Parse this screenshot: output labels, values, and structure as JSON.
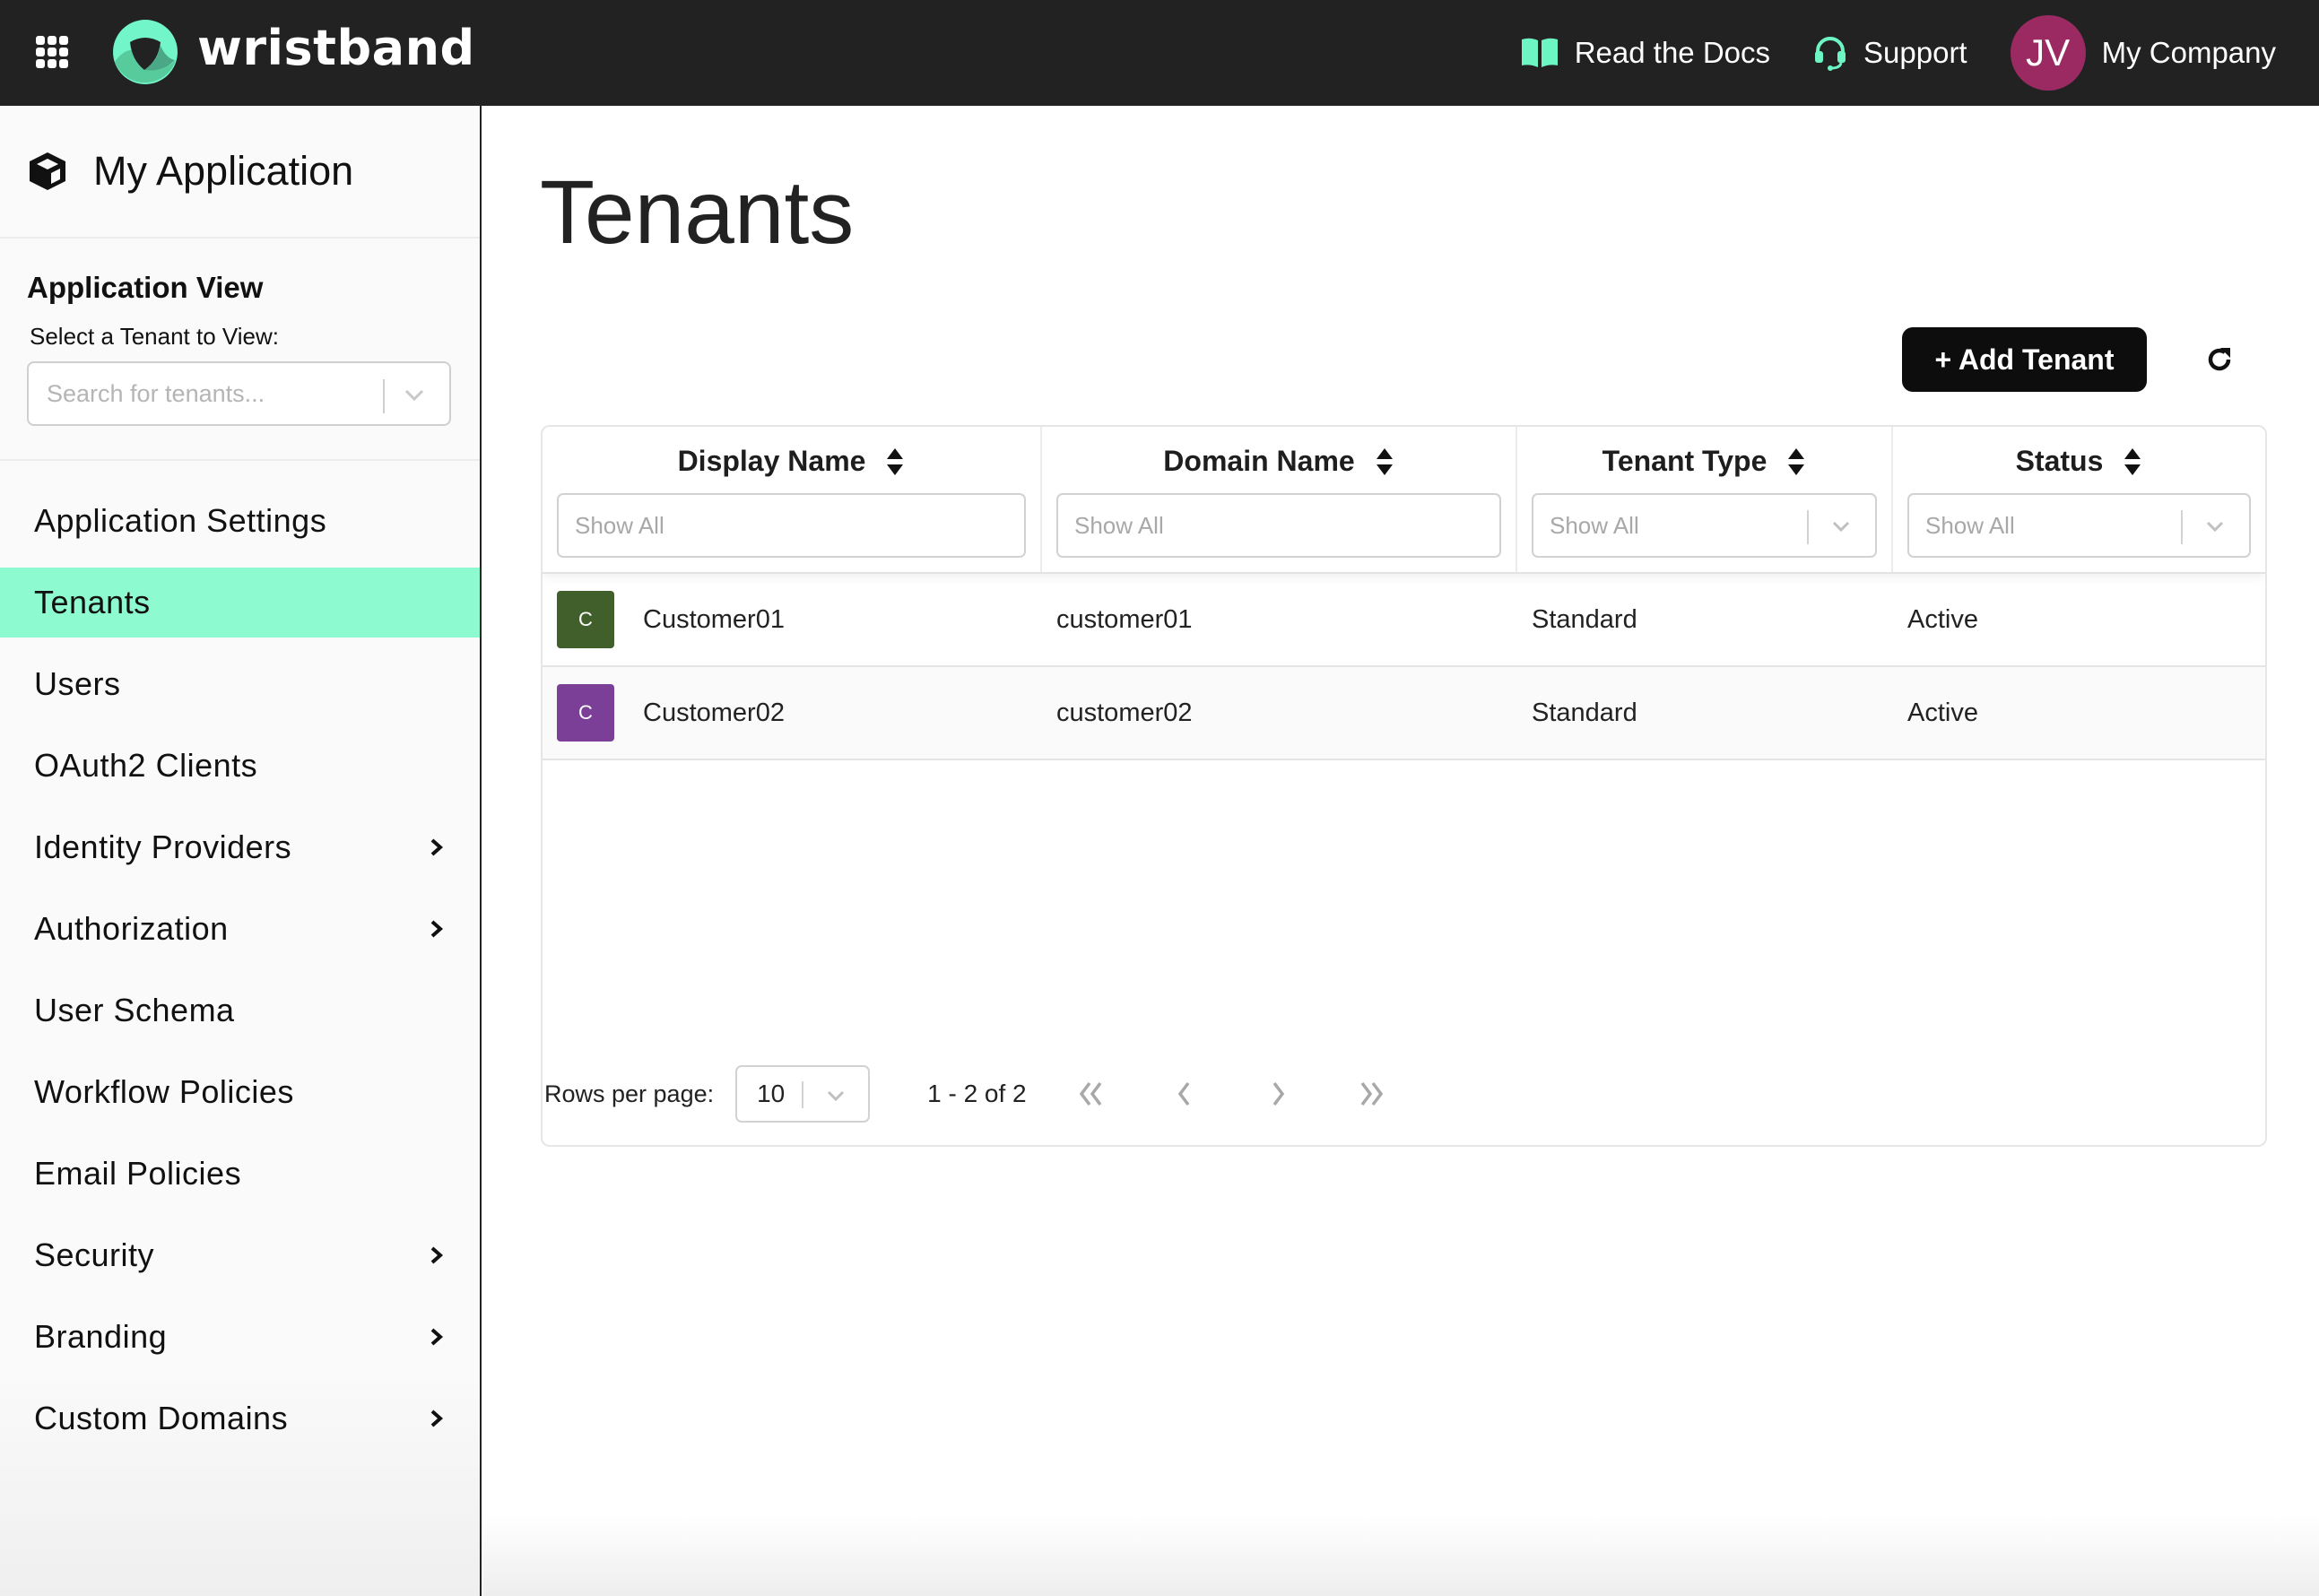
{
  "header": {
    "brand": "wristband",
    "docs_label": "Read the Docs",
    "support_label": "Support",
    "avatar_initials": "JV",
    "company_label": "My Company",
    "accent_color": "#6ef5c4",
    "avatar_color": "#9b2a62"
  },
  "sidebar": {
    "app_name": "My Application",
    "view_heading": "Application View",
    "select_label": "Select a Tenant to View:",
    "select_placeholder": "Search for tenants...",
    "items": [
      {
        "label": "Application Settings",
        "has_submenu": false,
        "active": false
      },
      {
        "label": "Tenants",
        "has_submenu": false,
        "active": true
      },
      {
        "label": "Users",
        "has_submenu": false,
        "active": false
      },
      {
        "label": "OAuth2 Clients",
        "has_submenu": false,
        "active": false
      },
      {
        "label": "Identity Providers",
        "has_submenu": true,
        "active": false
      },
      {
        "label": "Authorization",
        "has_submenu": true,
        "active": false
      },
      {
        "label": "User Schema",
        "has_submenu": false,
        "active": false
      },
      {
        "label": "Workflow Policies",
        "has_submenu": false,
        "active": false
      },
      {
        "label": "Email Policies",
        "has_submenu": false,
        "active": false
      },
      {
        "label": "Security",
        "has_submenu": true,
        "active": false
      },
      {
        "label": "Branding",
        "has_submenu": true,
        "active": false
      },
      {
        "label": "Custom Domains",
        "has_submenu": true,
        "active": false
      }
    ],
    "active_color": "#8efad0"
  },
  "main": {
    "title": "Tenants",
    "add_button_label": "+ Add Tenant",
    "refresh_icon": "refresh-icon"
  },
  "table": {
    "columns": [
      {
        "label": "Display Name",
        "filter_type": "text",
        "filter_placeholder": "Show All"
      },
      {
        "label": "Domain Name",
        "filter_type": "text",
        "filter_placeholder": "Show All"
      },
      {
        "label": "Tenant Type",
        "filter_type": "select",
        "filter_placeholder": "Show All"
      },
      {
        "label": "Status",
        "filter_type": "select",
        "filter_placeholder": "Show All"
      }
    ],
    "rows": [
      {
        "avatar_letter": "C",
        "avatar_color": "#415f2b",
        "display_name": "Customer01",
        "domain_name": "customer01",
        "tenant_type": "Standard",
        "status": "Active"
      },
      {
        "avatar_letter": "C",
        "avatar_color": "#7b3f98",
        "display_name": "Customer02",
        "domain_name": "customer02",
        "tenant_type": "Standard",
        "status": "Active"
      }
    ]
  },
  "pagination": {
    "rows_per_page_label": "Rows per page:",
    "rows_per_page_value": "10",
    "range_text": "1 - 2  of  2",
    "first_icon": "double-chevron-left-icon",
    "prev_icon": "chevron-left-icon",
    "next_icon": "chevron-right-icon",
    "last_icon": "double-chevron-right-icon"
  }
}
